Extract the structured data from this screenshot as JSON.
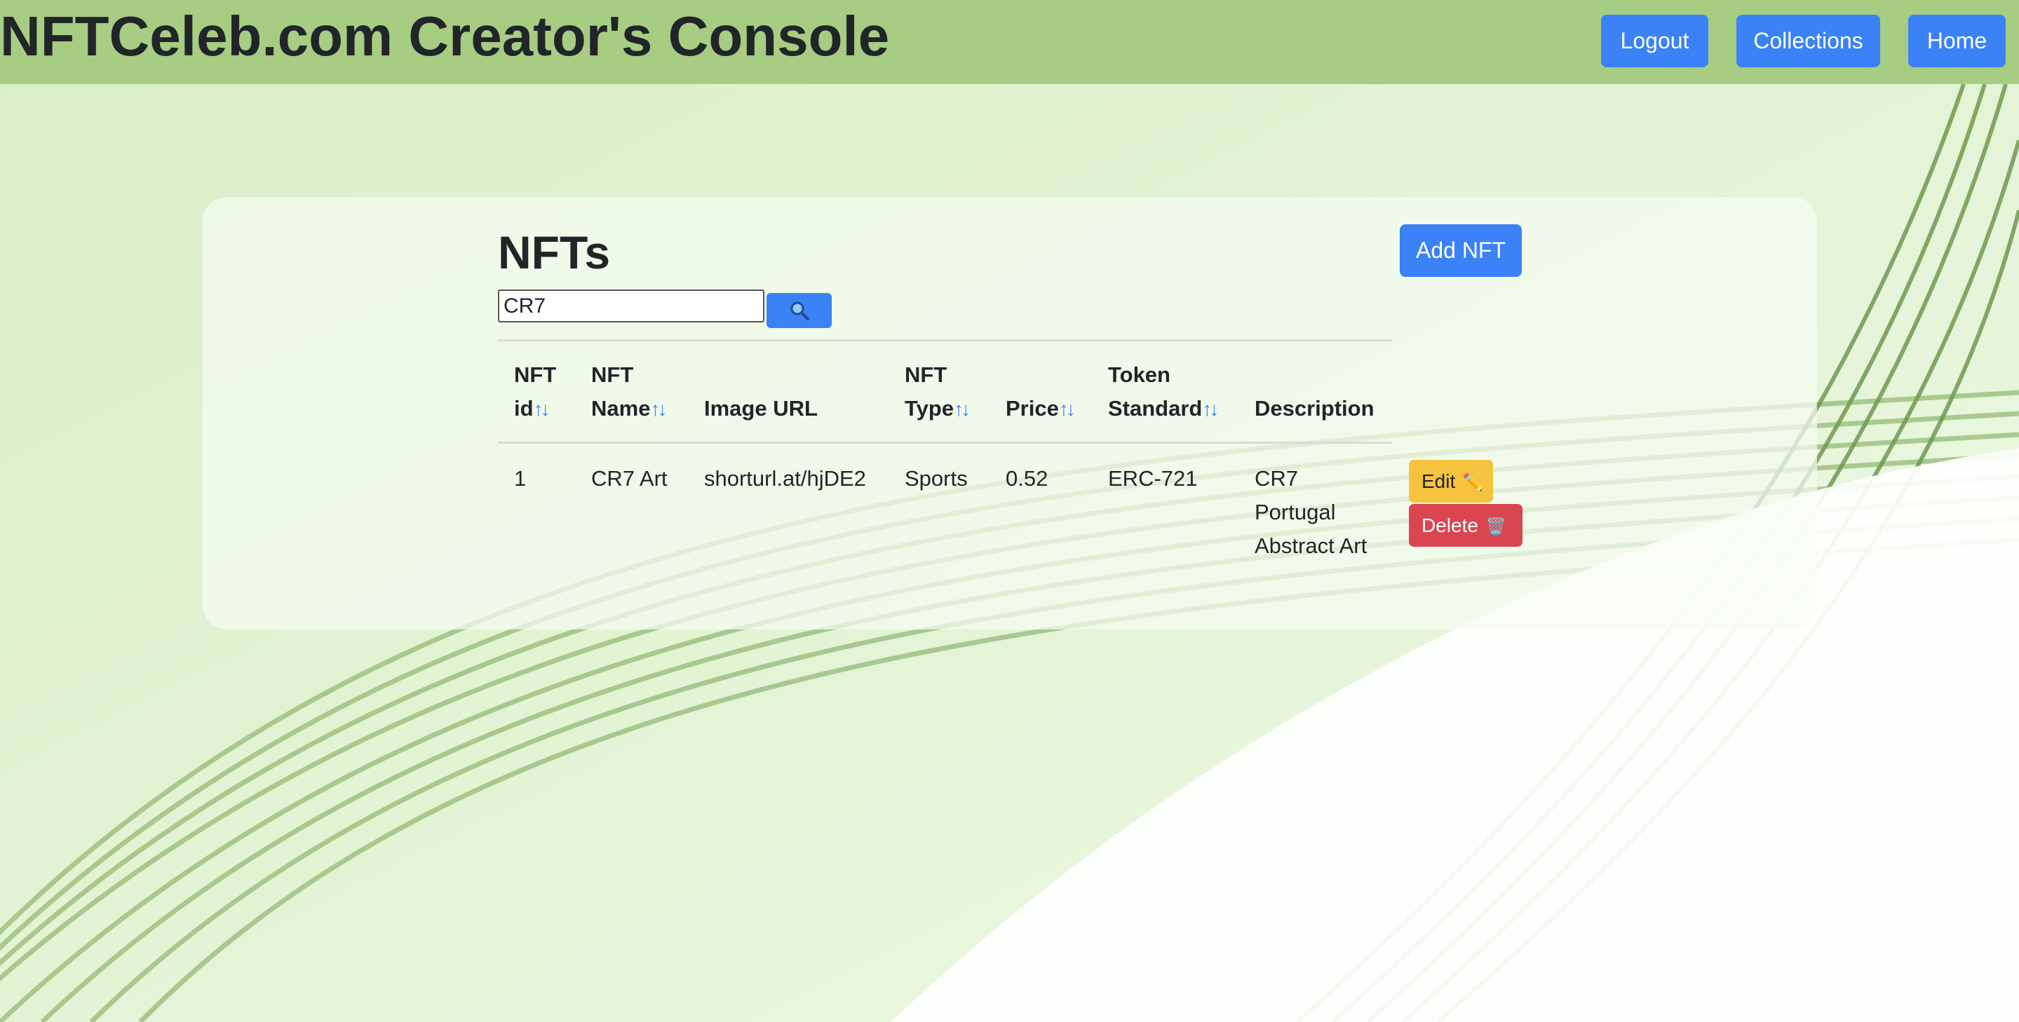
{
  "header": {
    "title": "NFTCeleb.com Creator's Console",
    "nav": {
      "logout": "Logout",
      "collections": "Collections",
      "home": "Home"
    }
  },
  "main": {
    "title": "NFTs",
    "add_button": "Add NFT",
    "search": {
      "value": "CR7",
      "button_icon": "search-icon"
    },
    "table": {
      "columns": [
        {
          "line1": "NFT",
          "line2": "id",
          "sortable": true
        },
        {
          "line1": "NFT",
          "line2": "Name",
          "sortable": true
        },
        {
          "line1": "",
          "line2": "Image URL",
          "sortable": false
        },
        {
          "line1": "NFT",
          "line2": "Type",
          "sortable": true
        },
        {
          "line1": "",
          "line2": "Price",
          "sortable": true
        },
        {
          "line1": "Token",
          "line2": "Standard",
          "sortable": true
        },
        {
          "line1": "",
          "line2": "Description",
          "sortable": false
        }
      ],
      "sort_glyph": "↑↓",
      "rows": [
        {
          "id": "1",
          "name": "CR7 Art",
          "image_url": "shorturl.at/hjDE2",
          "type": "Sports",
          "price": "0.52",
          "standard": "ERC-721",
          "description": [
            "CR7",
            "Portugal",
            "Abstract Art"
          ]
        }
      ],
      "edit_label": "Edit",
      "edit_icon": "✏️",
      "delete_label": "Delete",
      "delete_icon": "🗑️"
    }
  },
  "colors": {
    "navbar": "#a7cd82",
    "primary": "#3b82f6",
    "warning": "#f5c33e",
    "danger": "#d9464f"
  }
}
